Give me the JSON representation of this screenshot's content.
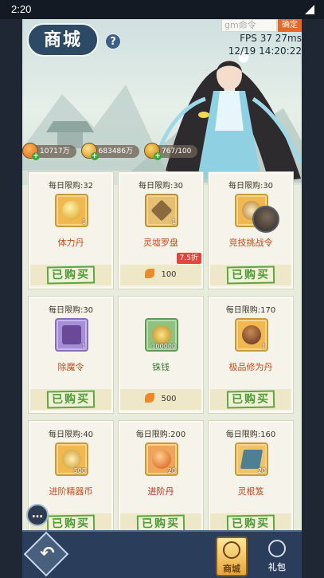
{
  "status_bar": {
    "time": "2:20"
  },
  "header": {
    "title": "商城",
    "gm_placeholder": "gm命令",
    "confirm_label": "确定",
    "fps_line": "FPS 37 27ms",
    "datetime": "12/19 14:20:22"
  },
  "currencies": [
    {
      "icon": "stamina-leaf-icon",
      "value": "10717万"
    },
    {
      "icon": "copper-coin-icon",
      "value": "683486万"
    },
    {
      "icon": "gold-coin-icon",
      "value": "767/100"
    }
  ],
  "items": [
    {
      "limit": "每日限购:32",
      "name": "体力丹",
      "qty": "1",
      "status": "bought",
      "bought_label": "已购买",
      "color": "#f2b850",
      "name_style": "orange"
    },
    {
      "limit": "每日限购:30",
      "name": "灵墟罗盘",
      "qty": "1",
      "status": "price",
      "price": "100",
      "discount": "7.5折",
      "name_style": "orange"
    },
    {
      "limit": "每日限购:30",
      "name": "竞技挑战令",
      "qty": "1",
      "status": "bought",
      "bought_label": "已购买",
      "name_style": "orange"
    },
    {
      "limit": "每日限购:30",
      "name": "除魔令",
      "qty": "1",
      "status": "bought",
      "bought_label": "已购买",
      "name_style": "orange"
    },
    {
      "limit": "",
      "name": "铢钱",
      "qty": "100000",
      "status": "price",
      "price": "500",
      "name_style": "green"
    },
    {
      "limit": "每日限购:170",
      "name": "极品修为丹",
      "qty": "1",
      "status": "bought",
      "bought_label": "已购买",
      "name_style": "orange"
    },
    {
      "limit": "每日限购:40",
      "name": "进阶精器币",
      "qty": "500",
      "status": "bought",
      "bought_label": "已购买",
      "name_style": "orange"
    },
    {
      "limit": "每日限购:200",
      "name": "进阶丹",
      "qty": "20",
      "status": "bought",
      "bought_label": "已购买",
      "name_style": "red"
    },
    {
      "limit": "每日限购:160",
      "name": "灵根笈",
      "qty": "20",
      "status": "bought",
      "bought_label": "已购买",
      "name_style": "orange"
    }
  ],
  "bottom_nav": {
    "shop_label": "商城",
    "gift_label": "礼包"
  },
  "colors": {
    "bought_green": "#4c9b36",
    "discount_red": "#e2453e",
    "accent_orange": "#e86724"
  }
}
